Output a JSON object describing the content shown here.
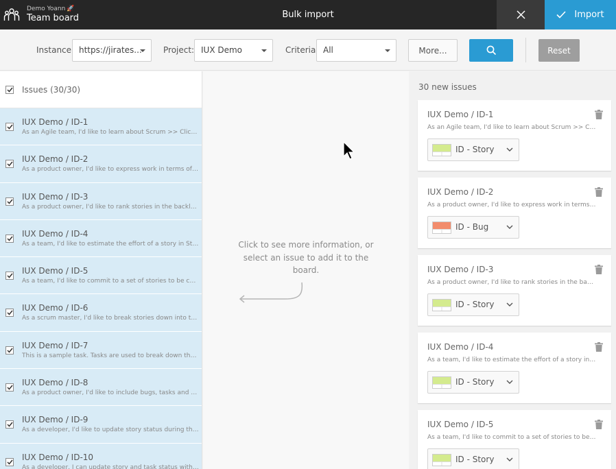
{
  "header": {
    "user": "Demo Yoann",
    "board": "Team board",
    "title": "Bulk import",
    "import_label": "Import",
    "accent": "#2a9bd3"
  },
  "filters": {
    "instance_label": "Instance:",
    "instance_value": "https://jirates...",
    "project_label": "Project:",
    "project_value": "IUX Demo",
    "criteria_label": "Criteria:",
    "criteria_value": "All",
    "more_label": "More...",
    "reset_label": "Reset"
  },
  "left": {
    "header_label": "Issues (30/30)",
    "issues": [
      {
        "title": "IUX Demo / ID-1",
        "desc": "As an Agile team, I'd like to learn about Scrum >> Click the \"I..."
      },
      {
        "title": "IUX Demo / ID-2",
        "desc": "As a product owner, I'd like to express work in terms of actua..."
      },
      {
        "title": "IUX Demo / ID-3",
        "desc": "As a product owner, I'd like to rank stories in the backlog so I..."
      },
      {
        "title": "IUX Demo / ID-4",
        "desc": "As a team, I'd like to estimate the effort of a story in Story Po..."
      },
      {
        "title": "IUX Demo / ID-5",
        "desc": "As a team, I'd like to commit to a set of stories to be complet..."
      },
      {
        "title": "IUX Demo / ID-6",
        "desc": "As a scrum master, I'd like to break stories down into tasks w..."
      },
      {
        "title": "IUX Demo / ID-7",
        "desc": "This is a sample task. Tasks are used to break down the steps..."
      },
      {
        "title": "IUX Demo / ID-8",
        "desc": "As a product owner, I'd like to include bugs, tasks and other i..."
      },
      {
        "title": "IUX Demo / ID-9",
        "desc": "As a developer, I'd like to update story status during the spri..."
      },
      {
        "title": "IUX Demo / ID-10",
        "desc": "As a developer, I can update story and task status with drag a..."
      }
    ]
  },
  "middle": {
    "hint": "Click to see more information, or select an issue to add it to the board."
  },
  "right": {
    "header_label": "30 new issues",
    "cards": [
      {
        "title": "IUX Demo / ID-1",
        "desc": "As an Agile team, I'd like to learn about Scrum >> Clic...",
        "type": "ID - Story",
        "color": "#d4eb8e"
      },
      {
        "title": "IUX Demo / ID-2",
        "desc": "As a product owner, I'd like to express work in terms o...",
        "type": "ID - Bug",
        "color": "#f28c6c"
      },
      {
        "title": "IUX Demo / ID-3",
        "desc": "As a product owner, I'd like to rank stories in the backl...",
        "type": "ID - Story",
        "color": "#d4eb8e"
      },
      {
        "title": "IUX Demo / ID-4",
        "desc": "As a team, I'd like to estimate the effort of a story in S...",
        "type": "ID - Story",
        "color": "#d4eb8e"
      },
      {
        "title": "IUX Demo / ID-5",
        "desc": "As a team, I'd like to commit to a set of stories to be c...",
        "type": "ID - Story",
        "color": "#d4eb8e"
      }
    ]
  }
}
